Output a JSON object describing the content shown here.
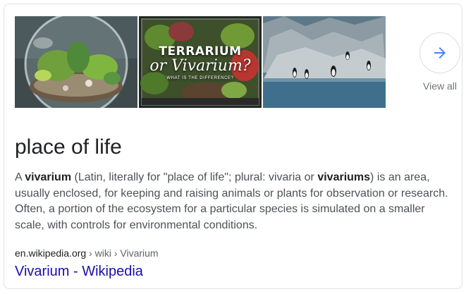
{
  "images": [
    {
      "alt": "terrarium-globe",
      "caption_lines": []
    },
    {
      "alt": "terrarium-vs-vivarium",
      "caption_lines": [
        "TERRARIUM",
        "or Vivarium?",
        "WHAT IS THE DIFFERENCE?"
      ]
    },
    {
      "alt": "penguin-exhibit",
      "caption_lines": []
    }
  ],
  "next_button": {
    "icon": "arrow-right-icon",
    "color": "#4285f4"
  },
  "view_all_label": "View all",
  "title": "place of life",
  "description": {
    "p1": "A ",
    "b1": "vivarium",
    "p2": " (Latin, literally for \"place of life\"; plural: vivaria or ",
    "b2": "vivariums",
    "p3": ") is an area, usually enclosed, for keeping and raising animals or plants for observation or research. Often, a portion of the ecosystem for a particular species is simulated on a smaller scale, with controls for environmental conditions."
  },
  "source": {
    "domain": "en.wikipedia.org",
    "path": " › wiki › Vivarium"
  },
  "link_text": "Vivarium - Wikipedia",
  "colors": {
    "link": "#1a0dab",
    "text": "#202124",
    "muted": "#70757a",
    "border": "#dfe1e5"
  }
}
